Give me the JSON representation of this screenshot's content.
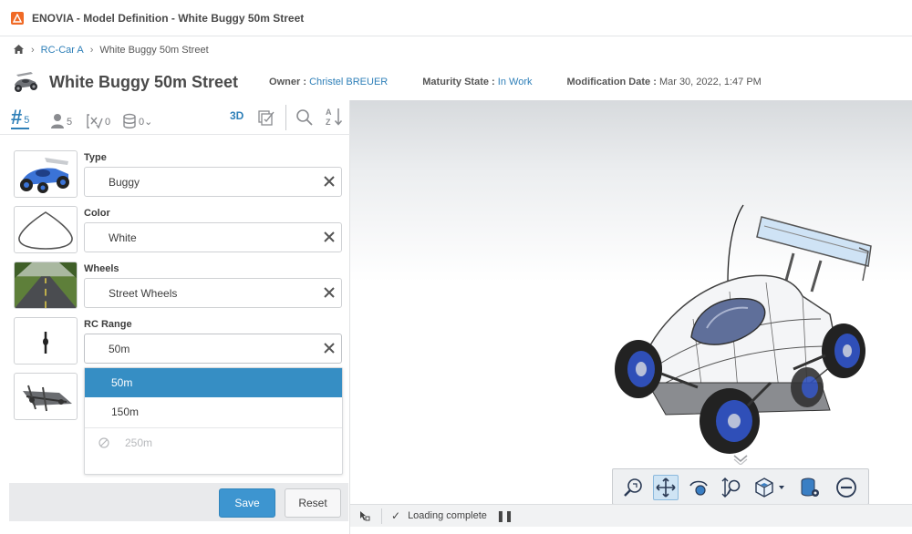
{
  "window": {
    "title": "ENOVIA - Model Definition - White Buggy 50m Street"
  },
  "breadcrumb": {
    "items": [
      "RC-Car A",
      "White Buggy 50m Street"
    ]
  },
  "object": {
    "title": "White Buggy 50m Street",
    "owner_label": "Owner :",
    "owner_value": "Christel BREUER",
    "maturity_label": "Maturity State :",
    "maturity_value": "In Work",
    "moddate_label": "Modification Date :",
    "moddate_value": "Mar 30, 2022, 1:47 PM"
  },
  "toolbar": {
    "attributes_count": "5",
    "users_count": "5",
    "rules_count": "0",
    "stack_count": "0",
    "view3d_label": "3D"
  },
  "attributes": [
    {
      "label": "Type",
      "value": "Buggy"
    },
    {
      "label": "Color",
      "value": "White"
    },
    {
      "label": "Wheels",
      "value": "Street Wheels"
    },
    {
      "label": "RC Range",
      "value": "50m"
    }
  ],
  "dropdown": {
    "options": [
      {
        "label": "50m",
        "state": "selected"
      },
      {
        "label": "150m",
        "state": "enabled"
      },
      {
        "label": "250m",
        "state": "disabled"
      }
    ]
  },
  "buttons": {
    "save": "Save",
    "reset": "Reset"
  },
  "status": {
    "message": "Loading complete"
  },
  "colors": {
    "accent": "#2e7fb8",
    "selected": "#368ec4",
    "save_button": "#3d95d0",
    "wheel_blue": "#2f4fb8"
  }
}
